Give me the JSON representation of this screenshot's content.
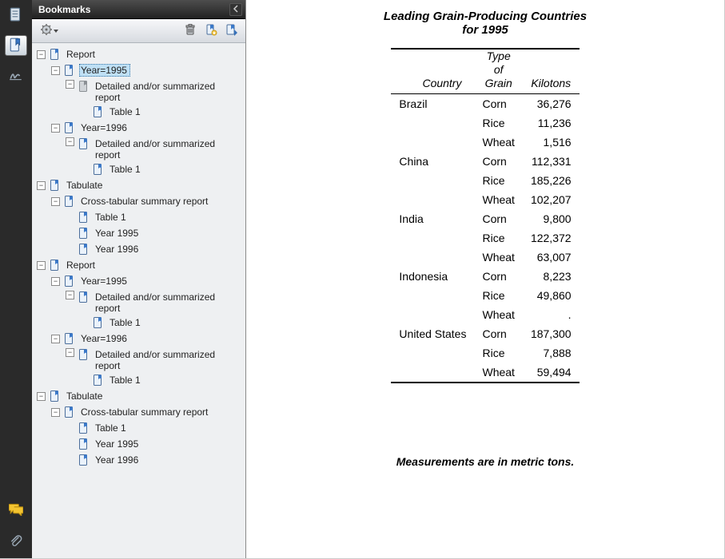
{
  "panel": {
    "title": "Bookmarks"
  },
  "icons": {
    "page_thumb": "page-thumbnails-icon",
    "bookmarks": "bookmarks-icon",
    "signature": "signature-icon",
    "comments": "comments-icon",
    "attachments": "attachments-icon",
    "gear": "options-gear-icon",
    "down": "chevron-down-icon",
    "trash": "trash-icon",
    "new_bookmark": "new-bookmark-icon",
    "bookmark_view": "bookmark-view-icon",
    "collapse": "collapse-panel-icon"
  },
  "tree": [
    {
      "label": "Report",
      "icon": "doc",
      "children": [
        {
          "label": "Year=1995",
          "icon": "doc",
          "selected": true,
          "children": [
            {
              "label": "Detailed and/or summarized report",
              "icon": "doc-grey",
              "wrap": true,
              "children": [
                {
                  "label": "Table 1",
                  "icon": "doc"
                }
              ]
            }
          ]
        },
        {
          "label": "Year=1996",
          "icon": "doc",
          "children": [
            {
              "label": "Detailed and/or summarized report",
              "icon": "doc",
              "wrap": true,
              "children": [
                {
                  "label": "Table 1",
                  "icon": "doc"
                }
              ]
            }
          ]
        }
      ]
    },
    {
      "label": "Tabulate",
      "icon": "doc",
      "children": [
        {
          "label": "Cross-tabular summary report",
          "icon": "doc",
          "children": [
            {
              "label": "Table 1",
              "icon": "doc"
            },
            {
              "label": "Year 1995",
              "icon": "doc"
            },
            {
              "label": "Year 1996",
              "icon": "doc"
            }
          ]
        }
      ]
    },
    {
      "label": "Report",
      "icon": "doc",
      "children": [
        {
          "label": "Year=1995",
          "icon": "doc",
          "children": [
            {
              "label": "Detailed and/or summarized report",
              "icon": "doc",
              "wrap": true,
              "children": [
                {
                  "label": "Table 1",
                  "icon": "doc"
                }
              ]
            }
          ]
        },
        {
          "label": "Year=1996",
          "icon": "doc",
          "children": [
            {
              "label": "Detailed and/or summarized report",
              "icon": "doc",
              "wrap": true,
              "children": [
                {
                  "label": "Table 1",
                  "icon": "doc"
                }
              ]
            }
          ]
        }
      ]
    },
    {
      "label": "Tabulate",
      "icon": "doc",
      "children": [
        {
          "label": "Cross-tabular summary report",
          "icon": "doc",
          "children": [
            {
              "label": "Table 1",
              "icon": "doc"
            },
            {
              "label": "Year 1995",
              "icon": "doc"
            },
            {
              "label": "Year 1996",
              "icon": "doc"
            }
          ]
        }
      ]
    }
  ],
  "doc": {
    "title_line1": "Leading Grain-Producing Countries",
    "title_line2": "for 1995",
    "col_country": "Country",
    "col_type1": "Type",
    "col_type2": "of",
    "col_type3": "Grain",
    "col_kilotons": "Kilotons",
    "footer": "Measurements are in metric tons.",
    "rows": [
      {
        "country": "Brazil",
        "grain": "Corn",
        "kilo": "36,276"
      },
      {
        "country": "",
        "grain": "Rice",
        "kilo": "11,236"
      },
      {
        "country": "",
        "grain": "Wheat",
        "kilo": "1,516"
      },
      {
        "country": "China",
        "grain": "Corn",
        "kilo": "112,331"
      },
      {
        "country": "",
        "grain": "Rice",
        "kilo": "185,226"
      },
      {
        "country": "",
        "grain": "Wheat",
        "kilo": "102,207"
      },
      {
        "country": "India",
        "grain": "Corn",
        "kilo": "9,800"
      },
      {
        "country": "",
        "grain": "Rice",
        "kilo": "122,372"
      },
      {
        "country": "",
        "grain": "Wheat",
        "kilo": "63,007"
      },
      {
        "country": "Indonesia",
        "grain": "Corn",
        "kilo": "8,223"
      },
      {
        "country": "",
        "grain": "Rice",
        "kilo": "49,860"
      },
      {
        "country": "",
        "grain": "Wheat",
        "kilo": "."
      },
      {
        "country": "United States",
        "grain": "Corn",
        "kilo": "187,300"
      },
      {
        "country": "",
        "grain": "Rice",
        "kilo": "7,888"
      },
      {
        "country": "",
        "grain": "Wheat",
        "kilo": "59,494"
      }
    ]
  },
  "chart_data": {
    "type": "table",
    "title": "Leading Grain-Producing Countries for 1995",
    "columns": [
      "Country",
      "Type of Grain",
      "Kilotons"
    ],
    "rows": [
      [
        "Brazil",
        "Corn",
        36276
      ],
      [
        "Brazil",
        "Rice",
        11236
      ],
      [
        "Brazil",
        "Wheat",
        1516
      ],
      [
        "China",
        "Corn",
        112331
      ],
      [
        "China",
        "Rice",
        185226
      ],
      [
        "China",
        "Wheat",
        102207
      ],
      [
        "India",
        "Corn",
        9800
      ],
      [
        "India",
        "Rice",
        122372
      ],
      [
        "India",
        "Wheat",
        63007
      ],
      [
        "Indonesia",
        "Corn",
        8223
      ],
      [
        "Indonesia",
        "Rice",
        49860
      ],
      [
        "Indonesia",
        "Wheat",
        null
      ],
      [
        "United States",
        "Corn",
        187300
      ],
      [
        "United States",
        "Rice",
        7888
      ],
      [
        "United States",
        "Wheat",
        59494
      ]
    ],
    "note": "Measurements are in metric tons."
  }
}
